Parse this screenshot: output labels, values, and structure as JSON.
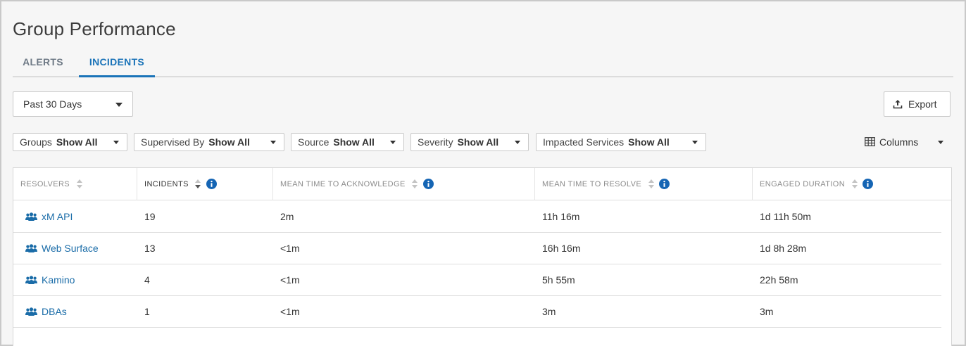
{
  "page": {
    "title": "Group Performance"
  },
  "tabs": [
    {
      "label": "ALERTS",
      "active": false
    },
    {
      "label": "INCIDENTS",
      "active": true
    }
  ],
  "date_range": {
    "selected": "Past 30 Days"
  },
  "export": {
    "label": "Export",
    "icon": "upload-icon"
  },
  "filters": [
    {
      "label": "Groups",
      "value": "Show All"
    },
    {
      "label": "Supervised By",
      "value": "Show All"
    },
    {
      "label": "Source",
      "value": "Show All"
    },
    {
      "label": "Severity",
      "value": "Show All"
    },
    {
      "label": "Impacted Services",
      "value": "Show All"
    }
  ],
  "columns_button": {
    "label": "Columns",
    "icon": "table-columns-icon"
  },
  "table": {
    "headers": [
      {
        "label": "RESOLVERS",
        "info": false
      },
      {
        "label": "INCIDENTS",
        "info": true
      },
      {
        "label": "MEAN TIME TO ACKNOWLEDGE",
        "info": true
      },
      {
        "label": "MEAN TIME TO RESOLVE",
        "info": true
      },
      {
        "label": "ENGAGED DURATION",
        "info": true
      }
    ],
    "rows": [
      {
        "resolver": "xM API",
        "incidents": "19",
        "mtta": "2m",
        "mttr": "11h 16m",
        "engaged": "1d 11h 50m"
      },
      {
        "resolver": "Web Surface",
        "incidents": "13",
        "mtta": "<1m",
        "mttr": "16h 16m",
        "engaged": "1d 8h 28m"
      },
      {
        "resolver": "Kamino",
        "incidents": "4",
        "mtta": "<1m",
        "mttr": "5h 55m",
        "engaged": "22h 58m"
      },
      {
        "resolver": "DBAs",
        "incidents": "1",
        "mtta": "<1m",
        "mttr": "3m",
        "engaged": "3m"
      }
    ]
  },
  "colors": {
    "accent": "#1a73b8",
    "link": "#1a6ca8",
    "info": "#1565b4"
  }
}
